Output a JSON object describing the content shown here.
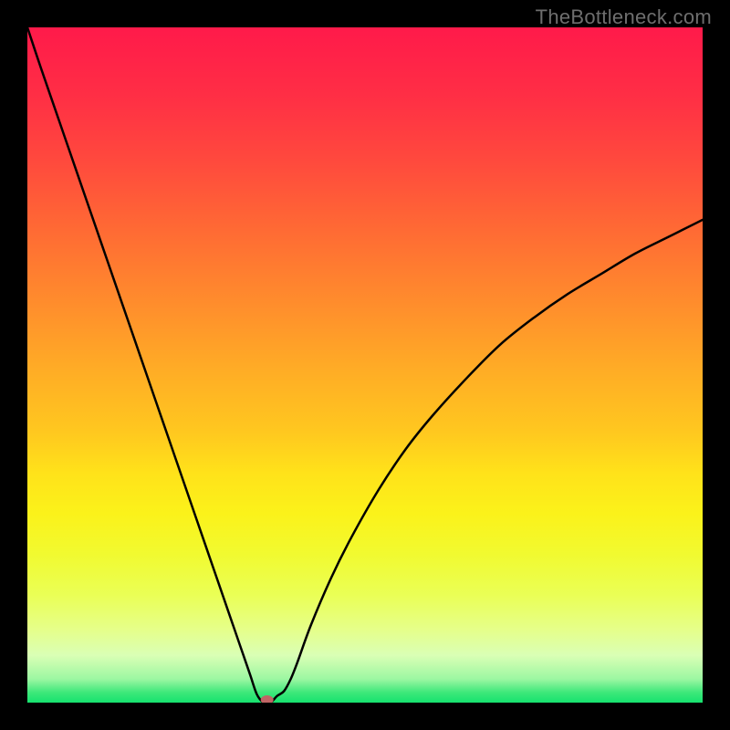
{
  "watermark": "TheBottleneck.com",
  "chart_data": {
    "type": "line",
    "title": "",
    "xlabel": "",
    "ylabel": "",
    "xlim": [
      0,
      100
    ],
    "ylim": [
      0,
      100
    ],
    "grid": false,
    "legend": false,
    "background_gradient_stops": [
      {
        "offset": 0.0,
        "color": "#ff1a4a"
      },
      {
        "offset": 0.1,
        "color": "#ff2e45"
      },
      {
        "offset": 0.2,
        "color": "#ff4a3d"
      },
      {
        "offset": 0.3,
        "color": "#ff6a34"
      },
      {
        "offset": 0.4,
        "color": "#ff8a2d"
      },
      {
        "offset": 0.5,
        "color": "#ffaa26"
      },
      {
        "offset": 0.6,
        "color": "#ffc81f"
      },
      {
        "offset": 0.66,
        "color": "#ffe21a"
      },
      {
        "offset": 0.72,
        "color": "#fbf21a"
      },
      {
        "offset": 0.78,
        "color": "#f1fa30"
      },
      {
        "offset": 0.84,
        "color": "#eaff55"
      },
      {
        "offset": 0.89,
        "color": "#e6ff88"
      },
      {
        "offset": 0.93,
        "color": "#daffb5"
      },
      {
        "offset": 0.965,
        "color": "#9cf7a2"
      },
      {
        "offset": 0.985,
        "color": "#3de87a"
      },
      {
        "offset": 1.0,
        "color": "#16e26e"
      }
    ],
    "curve": {
      "name": "bottleneck-curve",
      "x": [
        0,
        2,
        4,
        6,
        8,
        10,
        12,
        14,
        16,
        18,
        20,
        22,
        24,
        26,
        28,
        30,
        31,
        32,
        33,
        34,
        35,
        36,
        37,
        38,
        39,
        40,
        42,
        45,
        48,
        52,
        56,
        60,
        65,
        70,
        75,
        80,
        85,
        90,
        95,
        100
      ],
      "y": [
        100,
        94,
        88.2,
        82.4,
        76.6,
        70.8,
        65.0,
        59.2,
        53.4,
        47.6,
        41.8,
        36.0,
        30.2,
        24.4,
        18.6,
        12.8,
        9.9,
        7.0,
        4.1,
        1.2,
        0.0,
        0.0,
        1.0,
        1.7,
        3.5,
        6.0,
        11.5,
        18.5,
        24.5,
        31.5,
        37.5,
        42.5,
        48.0,
        53.0,
        57.0,
        60.5,
        63.5,
        66.5,
        69.0,
        71.5
      ]
    },
    "min_marker": {
      "x": 35.5,
      "y": 0.0,
      "color": "#c06565"
    }
  }
}
